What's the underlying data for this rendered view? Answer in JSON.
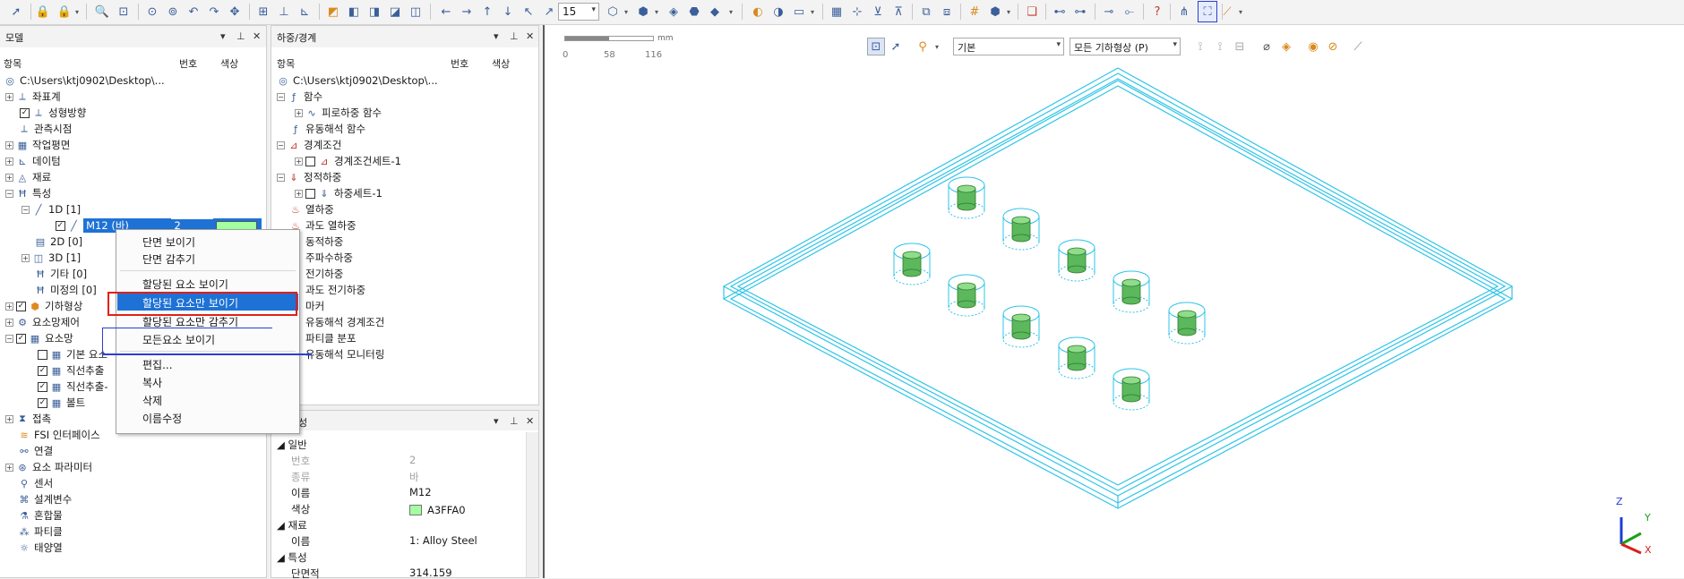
{
  "toolbar": {
    "zoom_value": "15",
    "icons": [
      "cursor-icon",
      "lock-icon",
      "lock-icon",
      "zoom-icon",
      "zoom-box-icon",
      "zoom-fit-icon",
      "zoom-area-icon",
      "rotate-icon",
      "rotate-icon",
      "pan-icon",
      "grid-icon",
      "axis-icon",
      "axis-icon",
      "cube-view-icon",
      "cube-view-icon",
      "cube-view-icon",
      "cube-view-icon",
      "cube-view-icon",
      "arrow-left-icon",
      "arrow-right-icon",
      "arrow-up-icon",
      "arrow-down-icon",
      "arrow-diag-icon",
      "arrow-diag-icon",
      "cube-icon",
      "cube-icon",
      "cube-icon",
      "cube-icon",
      "toggle-icon",
      "toggle-icon",
      "mesh-icon",
      "mesh-icon",
      "mesh-icon",
      "mesh-icon",
      "hash-icon",
      "cube-icon",
      "book-icon",
      "node-icon",
      "node-icon",
      "node-icon",
      "node-icon",
      "help-icon",
      "graph-icon",
      "graph-select-icon",
      "measure-icon"
    ]
  },
  "model_panel": {
    "title": "모델",
    "col_item": "항목",
    "col_num": "번호",
    "col_color": "색상",
    "path": "C:\\Users\\ktj0902\\Desktop\\...",
    "items": {
      "coord": "좌표계",
      "mesh_dir": "성형방향",
      "viewpoint": "관측시점",
      "workplane": "작업평면",
      "datum": "데이텀",
      "material": "재료",
      "property": "특성",
      "d1": "1D [1]",
      "m12": "M12 (바)",
      "m12_num": "2",
      "m12_color": "#A3FFA0",
      "d2": "2D [0]",
      "d3": "3D [1]",
      "other": "기타 [0]",
      "undef": "미정의 [0]",
      "geometry": "기하형상",
      "mesh_control": "요소망제어",
      "mesh": "요소망",
      "mesh_basic": "기본 요소",
      "mesh_line1": "직선추출",
      "mesh_line2": "직선추출-",
      "bolt": "볼트",
      "contact": "접촉",
      "fsi": "FSI 인터페이스",
      "connect": "연결",
      "elem_param": "요소 파라미터",
      "sensor": "센서",
      "design_var": "설계변수",
      "mixture": "혼합물",
      "particle": "파티클",
      "solar": "태양열"
    }
  },
  "context_menu": {
    "show_section": "단면 보이기",
    "hide_section": "단면 감추기",
    "show_assigned": "할당된 요소 보이기",
    "show_only_assigned": "할당된 요소만 보이기",
    "hide_assigned": "할당된 요소만 감추기",
    "show_all": "모든요소 보이기",
    "edit": "편집...",
    "copy": "복사",
    "delete": "삭제",
    "rename": "이름수정"
  },
  "load_panel": {
    "title": "하중/경계",
    "col_item": "항목",
    "col_num": "번호",
    "col_color": "색상",
    "path": "C:\\Users\\ktj0902\\Desktop\\...",
    "items": {
      "function": "함수",
      "fatigue_func": "피로하중 함수",
      "flow_func": "유동해석 함수",
      "bc": "경계조건",
      "bc_set": "경계조건세트-1",
      "static": "정적하중",
      "load_set": "하중세트-1",
      "thermal": "열하중",
      "transient_thermal": "과도 열하중",
      "dynamic": "동적하중",
      "frequency": "주파수하중",
      "electric": "전기하중",
      "transient_electric": "과도 전기하중",
      "marker": "마커",
      "flow_bc": "유동해석 경계조건",
      "particle_dist": "파티클 분포",
      "flow_monitor": "유동해석 모니터링"
    }
  },
  "property_panel": {
    "title_char": "성",
    "sec_general": "일반",
    "num_label": "번호",
    "num_value": "2",
    "kind_label": "종류",
    "kind_value": "바",
    "name_label": "이름",
    "name_value": "M12",
    "color_label": "색상",
    "color_value": "A3FFA0",
    "color_hex": "#A3FFA0",
    "sec_material": "재료",
    "mat_label": "이름",
    "mat_value": "1: Alloy Steel",
    "sec_prop": "특성",
    "area_label": "단면적",
    "area_value": "314.159"
  },
  "viewport": {
    "scale_unit": "mm",
    "scale_ticks": [
      "0",
      "58",
      "116"
    ],
    "display_combo": "기본",
    "geometry_combo": "모든 기하형상 (P)",
    "axes": {
      "z": "Z",
      "y": "Y",
      "x": "X"
    },
    "colors": {
      "wire": "#2ec4e8",
      "bolt": "#5cb85c"
    }
  }
}
